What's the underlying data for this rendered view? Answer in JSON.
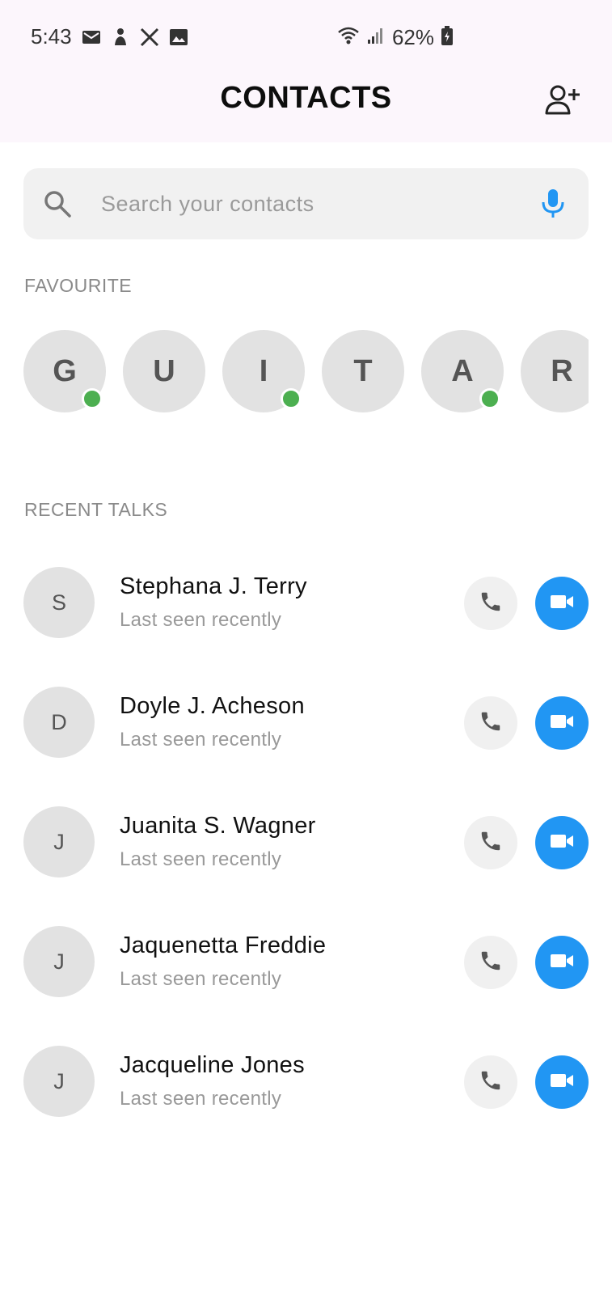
{
  "status_bar": {
    "time": "5:43",
    "battery": "62%",
    "left_icons": [
      "mail-icon",
      "figure-icon",
      "x-logo-icon",
      "image-icon"
    ],
    "right_icons": [
      "wifi-icon",
      "signal-icon",
      "battery-icon"
    ]
  },
  "header": {
    "title": "CONTACTS",
    "add_icon": "add-person-icon"
  },
  "search": {
    "placeholder": "Search your contacts",
    "value": "",
    "icons": [
      "search-icon",
      "mic-icon"
    ]
  },
  "favourites": {
    "label": "FAVOURITE",
    "items": [
      {
        "letter": "G",
        "online": true
      },
      {
        "letter": "U",
        "online": false
      },
      {
        "letter": "I",
        "online": true
      },
      {
        "letter": "T",
        "online": false
      },
      {
        "letter": "A",
        "online": true
      },
      {
        "letter": "R",
        "online": false
      }
    ]
  },
  "recent": {
    "label": "RECENT TALKS",
    "items": [
      {
        "initial": "S",
        "name": "Stephana J. Terry",
        "status": "Last seen recently"
      },
      {
        "initial": "D",
        "name": "Doyle J. Acheson",
        "status": "Last seen recently"
      },
      {
        "initial": "J",
        "name": "Juanita S. Wagner",
        "status": "Last seen recently"
      },
      {
        "initial": "J",
        "name": "Jaquenetta Freddie",
        "status": "Last seen recently"
      },
      {
        "initial": "J",
        "name": "Jacqueline Jones",
        "status": "Last seen recently"
      }
    ]
  },
  "colors": {
    "topbar_bg": "#fcf6fc",
    "accent": "#2196f3",
    "online": "#4caf50",
    "avatar_bg": "#e2e2e2"
  }
}
